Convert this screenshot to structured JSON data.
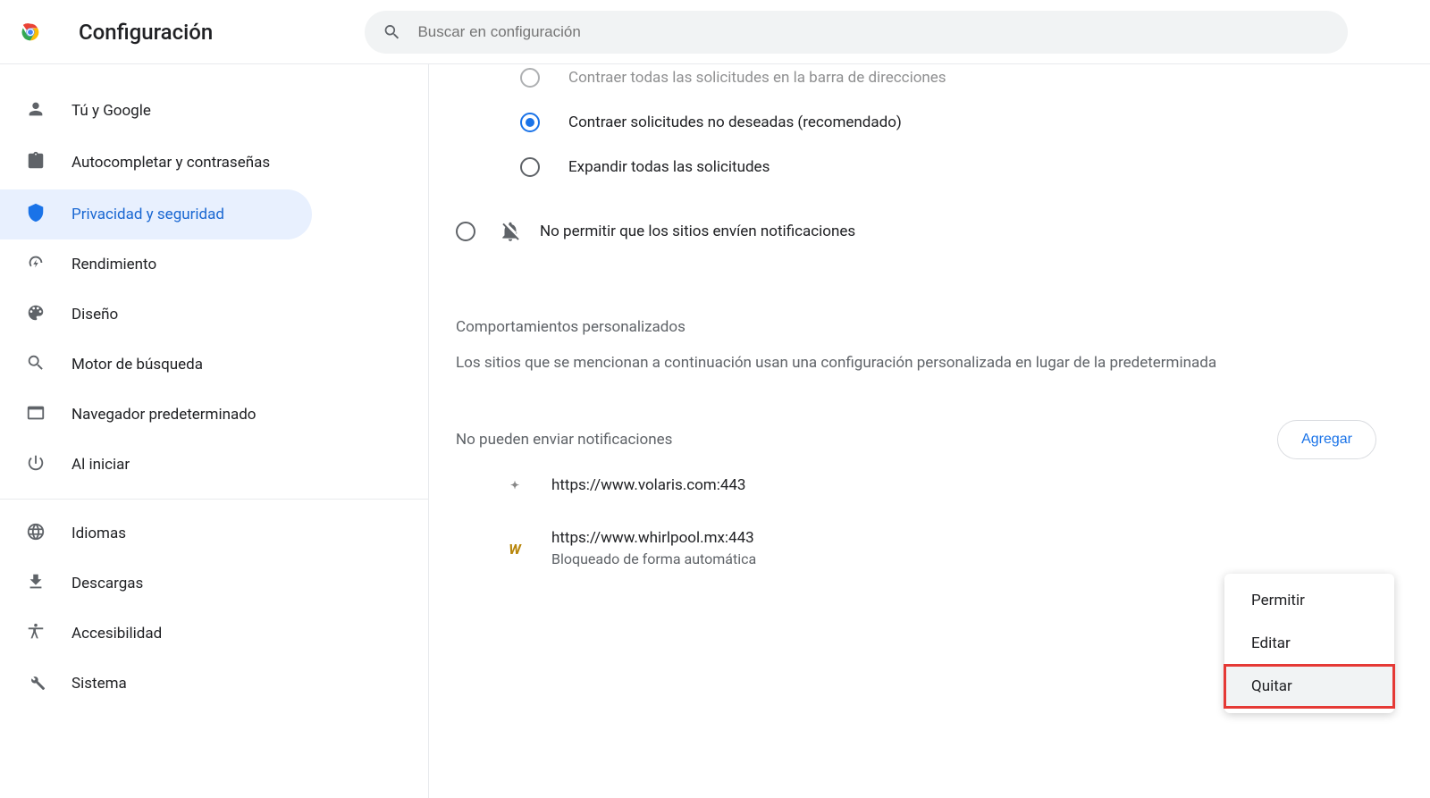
{
  "header": {
    "title": "Configuración",
    "search_placeholder": "Buscar en configuración"
  },
  "sidebar": {
    "group1": [
      {
        "label": "Tú y Google"
      },
      {
        "label": "Autocompletar y contraseñas"
      },
      {
        "label": "Privacidad y seguridad"
      },
      {
        "label": "Rendimiento"
      },
      {
        "label": "Diseño"
      },
      {
        "label": "Motor de búsqueda"
      },
      {
        "label": "Navegador predeterminado"
      },
      {
        "label": "Al iniciar"
      }
    ],
    "group2": [
      {
        "label": "Idiomas"
      },
      {
        "label": "Descargas"
      },
      {
        "label": "Accesibilidad"
      },
      {
        "label": "Sistema"
      }
    ]
  },
  "content": {
    "radios": {
      "cut_top": "Contraer todas las solicitudes en la barra de direcciones",
      "collapse_unwanted": "Contraer solicitudes no deseadas (recomendado)",
      "expand_all": "Expandir todas las solicitudes",
      "block_all": "No permitir que los sitios envíen notificaciones"
    },
    "custom_heading": "Comportamientos personalizados",
    "custom_desc": "Los sitios que se mencionan a continuación usan una configuración personalizada en lugar de la predeterminada",
    "blocked_label": "No pueden enviar notificaciones",
    "add_label": "Agregar",
    "sites": [
      {
        "url": "https://www.volaris.com:443",
        "sub": "",
        "fav": "✦"
      },
      {
        "url": "https://www.whirlpool.mx:443",
        "sub": "Bloqueado de forma automática",
        "fav": "W"
      }
    ]
  },
  "menu": {
    "allow": "Permitir",
    "edit": "Editar",
    "remove": "Quitar"
  }
}
